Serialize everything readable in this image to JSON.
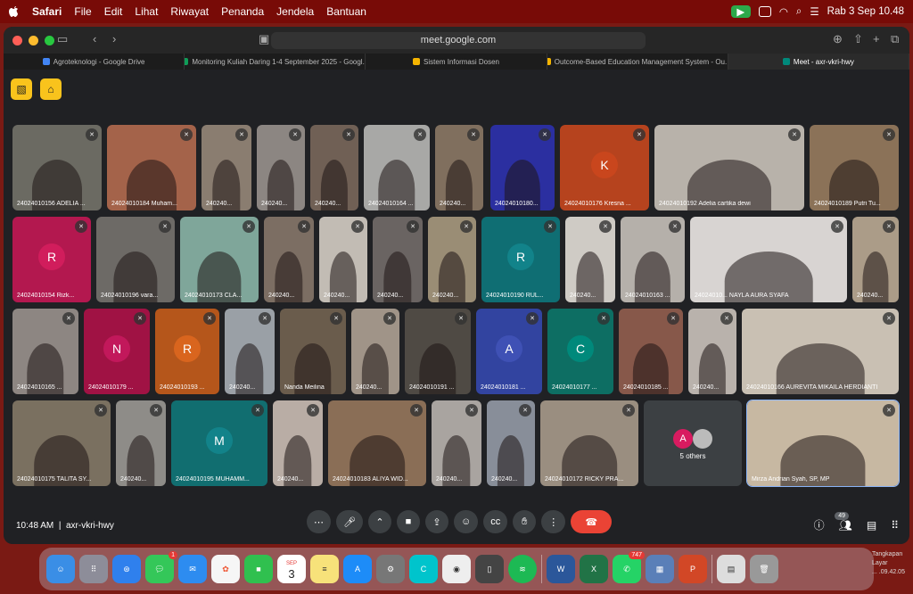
{
  "menubar": {
    "app": "Safari",
    "items": [
      "File",
      "Edit",
      "Lihat",
      "Riwayat",
      "Penanda",
      "Jendela",
      "Bantuan"
    ],
    "datetime": "Rab 3 Sep  10.48"
  },
  "browser": {
    "url": "meet.google.com",
    "tabs": [
      {
        "label": "Agroteknologi - Google Drive",
        "color": "#4285f4"
      },
      {
        "label": "Monitoring Kuliah Daring 1-4 September 2025 - Googl...",
        "color": "#0f9d58"
      },
      {
        "label": "Sistem Informasi Dosen",
        "color": "#f4b400"
      },
      {
        "label": "Outcome-Based Education Management System - Ou...",
        "color": "#f4b400"
      },
      {
        "label": "Meet - axr-vkri-hwy",
        "color": "#00897b"
      }
    ]
  },
  "tiles": [
    {
      "name": "24024010156 ADELIA ...",
      "bg": "#6b6a62",
      "avatar": "",
      "avc": ""
    },
    {
      "name": "24024010184 Muham...",
      "bg": "#a4634a",
      "avatar": "",
      "avc": ""
    },
    {
      "name": "240240...",
      "bg": "#8a7d70",
      "avatar": "",
      "avc": ""
    },
    {
      "name": "240240...",
      "bg": "#8c8682",
      "avatar": "",
      "avc": ""
    },
    {
      "name": "240240...",
      "bg": "#706055",
      "avatar": "",
      "avc": ""
    },
    {
      "name": "24024010164 ...",
      "bg": "#a8a8a6",
      "avatar": "",
      "avc": ""
    },
    {
      "name": "240240...",
      "bg": "#806f5e",
      "avatar": "",
      "avc": ""
    },
    {
      "name": "24024010180...",
      "bg": "#2b2fa0",
      "avatar": "",
      "avc": ""
    },
    {
      "name": "24024010176 Kresna ...",
      "bg": "#b6431e",
      "avatar": "K",
      "avc": "#c9461d"
    },
    {
      "name": "24024010192 Adelia cartika dewi",
      "bg": "#b8b2aa",
      "avatar": "",
      "avc": ""
    },
    {
      "name": "24024010189 Putri Tu...",
      "bg": "#8b7258",
      "avatar": "",
      "avc": ""
    },
    {
      "name": "24024010154 Rizk...",
      "bg": "#b3184f",
      "avatar": "R",
      "avc": "#d11d5c"
    },
    {
      "name": "24024010196 vara...",
      "bg": "#6d6a66",
      "avatar": "",
      "avc": ""
    },
    {
      "name": "24024010173 CLA...",
      "bg": "#7fa69a",
      "avatar": "",
      "avc": ""
    },
    {
      "name": "240240...",
      "bg": "#7c6e63",
      "avatar": "",
      "avc": ""
    },
    {
      "name": "240240...",
      "bg": "#c2bcb4",
      "avatar": "",
      "avc": ""
    },
    {
      "name": "240240...",
      "bg": "#6a6462",
      "avatar": "",
      "avc": ""
    },
    {
      "name": "240240...",
      "bg": "#9a8d75",
      "avatar": "",
      "avc": ""
    },
    {
      "name": "24024010190 RUL...",
      "bg": "#0f6e73",
      "avatar": "R",
      "avc": "#12838a"
    },
    {
      "name": "240240...",
      "bg": "#cfcbc5",
      "avatar": "",
      "avc": ""
    },
    {
      "name": "24024010163 ...",
      "bg": "#b5b0aa",
      "avatar": "",
      "avc": ""
    },
    {
      "name": "24024010... NAYLA AURA SYAFA",
      "bg": "#d8d4d2",
      "avatar": "",
      "avc": ""
    },
    {
      "name": "240240...",
      "bg": "#ab9c88",
      "avatar": "",
      "avc": ""
    },
    {
      "name": "24024010165 ...",
      "bg": "#8d8682",
      "avatar": "",
      "avc": ""
    },
    {
      "name": "24024010179 ...",
      "bg": "#a01244",
      "avatar": "N",
      "avc": "#c2185b"
    },
    {
      "name": "24024010193 ...",
      "bg": "#b5561b",
      "avatar": "R",
      "avc": "#d9651e"
    },
    {
      "name": "240240...",
      "bg": "#9aa0a6",
      "avatar": "",
      "avc": ""
    },
    {
      "name": "Nanda Meilina",
      "bg": "#6a5c4c",
      "avatar": "",
      "avc": ""
    },
    {
      "name": "240240...",
      "bg": "#a09488",
      "avatar": "",
      "avc": ""
    },
    {
      "name": "24024010191 ...",
      "bg": "#4f4a44",
      "avatar": "",
      "avc": ""
    },
    {
      "name": "24024010181 ...",
      "bg": "#3244a0",
      "avatar": "A",
      "avc": "#3f51b5"
    },
    {
      "name": "24024010177 ...",
      "bg": "#0d6e63",
      "avatar": "C",
      "avc": "#00897b"
    },
    {
      "name": "24024010185 ...",
      "bg": "#87584a",
      "avatar": "",
      "avc": ""
    },
    {
      "name": "240240...",
      "bg": "#b9b2ac",
      "avatar": "",
      "avc": ""
    },
    {
      "name": "24024010166 AUREVITA MIKAILA HERDIANTI",
      "bg": "#c9c0b3",
      "avatar": "",
      "avc": ""
    },
    {
      "name": "24024010175 TALITA SY...",
      "bg": "#7a7060",
      "avatar": "",
      "avc": ""
    },
    {
      "name": "240240...",
      "bg": "#8e8c88",
      "avatar": "",
      "avc": ""
    },
    {
      "name": "24024010195 MUHAMM...",
      "bg": "#116e70",
      "avatar": "M",
      "avc": "#12838a"
    },
    {
      "name": "240240...",
      "bg": "#b9ada5",
      "avatar": "",
      "avc": ""
    },
    {
      "name": "24024010183 ALIYA WID...",
      "bg": "#8a6e56",
      "avatar": "",
      "avc": ""
    },
    {
      "name": "240240...",
      "bg": "#a9a4a0",
      "avatar": "",
      "avc": ""
    },
    {
      "name": "240240...",
      "bg": "#888e99",
      "avatar": "",
      "avc": ""
    },
    {
      "name": "24024010172 RICKY PRA...",
      "bg": "#9a8e80",
      "avatar": "",
      "avc": ""
    },
    {
      "name": "5 others",
      "bg": "#3c4043",
      "avatar": "A",
      "avc": "#d81b60"
    },
    {
      "name": "Mirza Andrian Syah, SP, MP",
      "bg": "#c7b8a2",
      "avatar": "",
      "avc": ""
    }
  ],
  "meeting": {
    "time": "10:48 AM",
    "code": "axr-vkri-hwy",
    "participants": "49"
  },
  "dock": {
    "calendar_month": "SEP",
    "calendar_day": "3",
    "messages_badge": "1",
    "whatsapp_badge": "747",
    "screenshot_label": "Tangkapan Layar",
    "screenshot_time": "... .09.42.05"
  }
}
